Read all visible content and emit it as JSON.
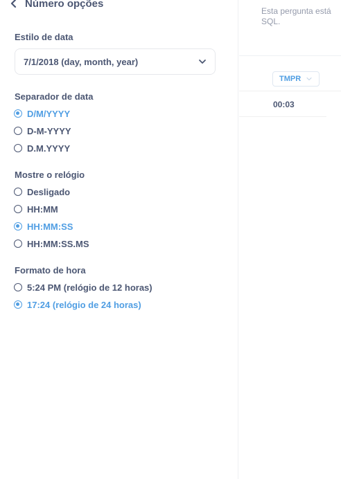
{
  "sidebar": {
    "title": "Número opções",
    "date_style": {
      "label": "Estilo de data",
      "selected": "7/1/2018 (day, month, year)"
    },
    "date_separator": {
      "label": "Separador de data",
      "options": [
        {
          "label": "D/M/YYYY",
          "selected": true
        },
        {
          "label": "D-M-YYYY",
          "selected": false
        },
        {
          "label": "D.M.YYYY",
          "selected": false
        }
      ]
    },
    "show_clock": {
      "label": "Mostre o relógio",
      "options": [
        {
          "label": "Desligado",
          "selected": false
        },
        {
          "label": "HH:MM",
          "selected": false
        },
        {
          "label": "HH:MM:SS",
          "selected": true
        },
        {
          "label": "HH:MM:SS.MS",
          "selected": false
        }
      ]
    },
    "time_format": {
      "label": "Formato de hora",
      "options": [
        {
          "label": "5:24 PM (relógio de 12 horas)",
          "selected": false
        },
        {
          "label": "17:24 (relógio de 24 horas)",
          "selected": true
        }
      ]
    }
  },
  "main": {
    "notice_line1": "Esta pergunta está",
    "notice_line2": "SQL.",
    "column_header": "TMPR",
    "cell_value": "00:03"
  },
  "colors": {
    "accent": "#509ee3",
    "text": "#4c5773",
    "muted": "#949aab"
  }
}
